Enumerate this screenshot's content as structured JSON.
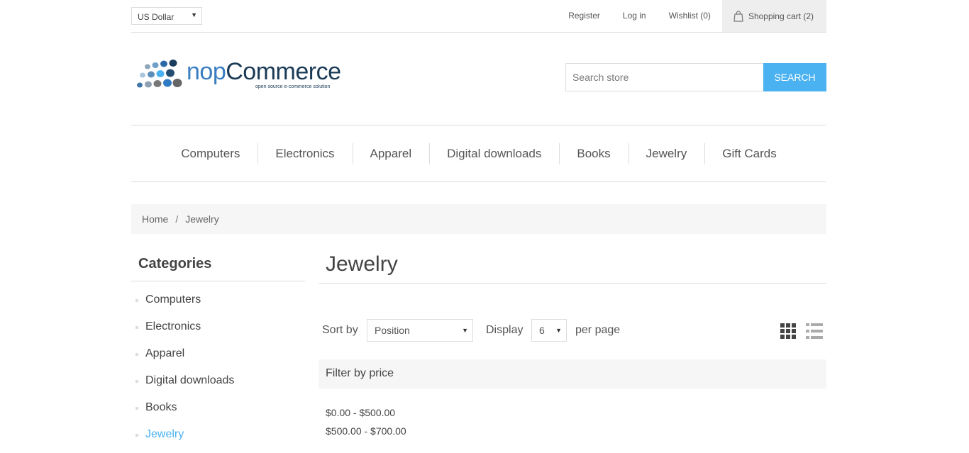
{
  "header": {
    "currency": "US Dollar",
    "links": {
      "register": "Register",
      "login": "Log in",
      "wishlist": "Wishlist (0)",
      "cart": "Shopping cart (2)"
    }
  },
  "logo": {
    "brand_a": "nop",
    "brand_b": "Commerce",
    "tagline": "open source e-commerce solution"
  },
  "search": {
    "placeholder": "Search store",
    "button": "SEARCH"
  },
  "menu": [
    "Computers",
    "Electronics",
    "Apparel",
    "Digital downloads",
    "Books",
    "Jewelry",
    "Gift Cards"
  ],
  "breadcrumb": {
    "home": "Home",
    "separator": "/",
    "current": "Jewelry"
  },
  "sidebar": {
    "title": "Categories",
    "items": [
      "Computers",
      "Electronics",
      "Apparel",
      "Digital downloads",
      "Books",
      "Jewelry"
    ]
  },
  "main": {
    "title": "Jewelry",
    "sort_label": "Sort by",
    "sort_value": "Position",
    "display_label": "Display",
    "display_value": "6",
    "per_page_label": "per page",
    "filter_title": "Filter by price",
    "price_ranges": [
      "$0.00 - $500.00",
      "$500.00 - $700.00"
    ]
  },
  "colors": {
    "accent": "#4ab2f1",
    "menu_text": "#555555",
    "border": "#dddddd"
  }
}
